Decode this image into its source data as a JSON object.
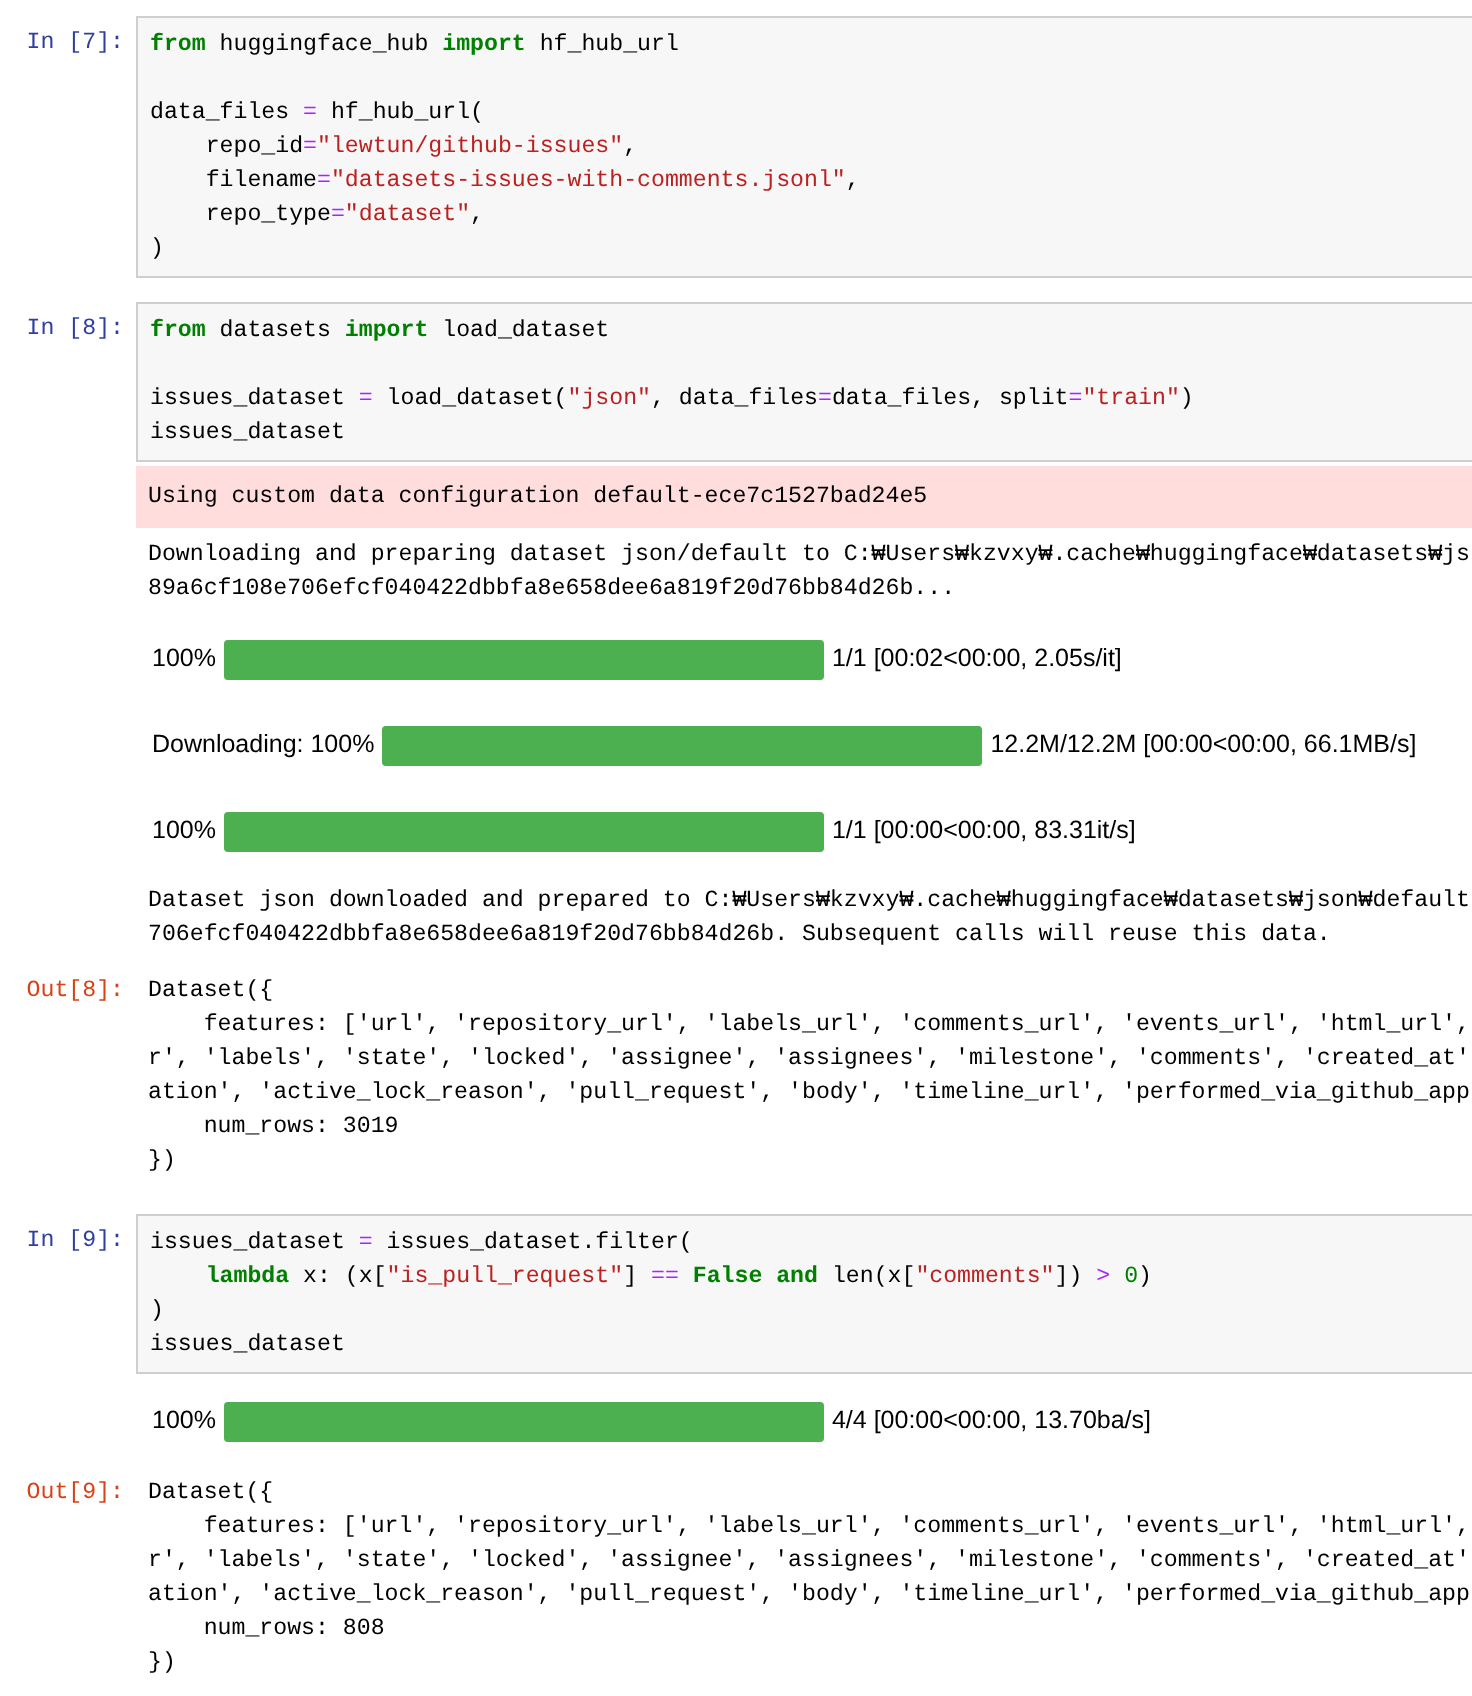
{
  "cells": [
    {
      "prompt": "In [7]:",
      "code": [
        {
          "tokens": [
            {
              "kind": "kw",
              "text": "from"
            },
            {
              "kind": "plain",
              "text": " huggingface_hub "
            },
            {
              "kind": "kw",
              "text": "import"
            },
            {
              "kind": "plain",
              "text": " hf_hub_url"
            }
          ]
        },
        {
          "kind": "blank"
        },
        {
          "tokens": [
            {
              "kind": "plain",
              "text": "data_files "
            },
            {
              "kind": "op",
              "text": "="
            },
            {
              "kind": "plain",
              "text": " hf_hub_url("
            }
          ]
        },
        {
          "tokens": [
            {
              "kind": "plain",
              "text": "    repo_id"
            },
            {
              "kind": "op",
              "text": "="
            },
            {
              "kind": "str",
              "text": "\"lewtun/github-issues\""
            },
            {
              "kind": "plain",
              "text": ","
            }
          ]
        },
        {
          "tokens": [
            {
              "kind": "plain",
              "text": "    filename"
            },
            {
              "kind": "op",
              "text": "="
            },
            {
              "kind": "str",
              "text": "\"datasets-issues-with-comments.jsonl\""
            },
            {
              "kind": "plain",
              "text": ","
            }
          ]
        },
        {
          "tokens": [
            {
              "kind": "plain",
              "text": "    repo_type"
            },
            {
              "kind": "op",
              "text": "="
            },
            {
              "kind": "str",
              "text": "\"dataset\""
            },
            {
              "kind": "plain",
              "text": ","
            }
          ]
        },
        {
          "tokens": [
            {
              "kind": "plain",
              "text": ")"
            }
          ]
        }
      ]
    },
    {
      "prompt": "In [8]:",
      "code": [
        {
          "tokens": [
            {
              "kind": "kw",
              "text": "from"
            },
            {
              "kind": "plain",
              "text": " datasets "
            },
            {
              "kind": "kw",
              "text": "import"
            },
            {
              "kind": "plain",
              "text": " load_dataset"
            }
          ]
        },
        {
          "kind": "blank"
        },
        {
          "tokens": [
            {
              "kind": "plain",
              "text": "issues_dataset "
            },
            {
              "kind": "op",
              "text": "="
            },
            {
              "kind": "plain",
              "text": " load_dataset("
            },
            {
              "kind": "str",
              "text": "\"json\""
            },
            {
              "kind": "plain",
              "text": ", data_files"
            },
            {
              "kind": "op",
              "text": "="
            },
            {
              "kind": "plain",
              "text": "data_files, split"
            },
            {
              "kind": "op",
              "text": "="
            },
            {
              "kind": "str",
              "text": "\"train\""
            },
            {
              "kind": "plain",
              "text": ")"
            }
          ]
        },
        {
          "tokens": [
            {
              "kind": "plain",
              "text": "issues_dataset"
            }
          ]
        }
      ],
      "outputs": [
        {
          "kind": "stderr",
          "lines": [
            "Using custom data configuration default-ece7c1527bad24e5"
          ]
        },
        {
          "kind": "stdout",
          "lines": [
            "Downloading and preparing dataset json/default to C:₩Users₩kzvxy₩.cache₩huggingface₩datasets₩js",
            "89a6cf108e706efcf040422dbbfa8e658dee6a819f20d76bb84d26b..."
          ]
        },
        {
          "kind": "progress",
          "label": "100%",
          "level": 1,
          "reading": "1/1 [00:02<00:00, 2.05s/it]"
        },
        {
          "kind": "progress",
          "label": "Downloading: 100%",
          "level": 1,
          "reading": "12.2M/12.2M [00:00<00:00, 66.1MB/s]"
        },
        {
          "kind": "progress",
          "label": "100%",
          "level": 1,
          "reading": "1/1 [00:00<00:00, 83.31it/s]"
        },
        {
          "kind": "stdout",
          "lines": [
            "Dataset json downloaded and prepared to C:₩Users₩kzvxy₩.cache₩huggingface₩datasets₩json₩default",
            "706efcf040422dbbfa8e658dee6a819f20d76bb84d26b. Subsequent calls will reuse this data."
          ]
        },
        {
          "kind": "result",
          "prompt": "Out[8]:",
          "lines": [
            "Dataset({",
            "    features: ['url', 'repository_url', 'labels_url', 'comments_url', 'events_url', 'html_url',",
            "r', 'labels', 'state', 'locked', 'assignee', 'assignees', 'milestone', 'comments', 'created_at'",
            "ation', 'active_lock_reason', 'pull_request', 'body', 'timeline_url', 'performed_via_github_app",
            "    num_rows: 3019",
            "})"
          ]
        }
      ]
    },
    {
      "prompt": "In [9]:",
      "code": [
        {
          "tokens": [
            {
              "kind": "plain",
              "text": "issues_dataset "
            },
            {
              "kind": "op",
              "text": "="
            },
            {
              "kind": "plain",
              "text": " issues_dataset.filter("
            }
          ]
        },
        {
          "tokens": [
            {
              "kind": "kw",
              "text": "    lambda"
            },
            {
              "kind": "plain",
              "text": " x: (x["
            },
            {
              "kind": "str",
              "text": "\"is_pull_request\""
            },
            {
              "kind": "plain",
              "text": "] "
            },
            {
              "kind": "op",
              "text": "== "
            },
            {
              "kind": "kw",
              "text": "False and"
            },
            {
              "kind": "plain",
              "text": " len(x["
            },
            {
              "kind": "str",
              "text": "\"comments\""
            },
            {
              "kind": "plain",
              "text": "]) "
            },
            {
              "kind": "op",
              "text": "> "
            },
            {
              "kind": "num",
              "text": "0"
            },
            {
              "kind": "plain",
              "text": ")"
            }
          ]
        },
        {
          "tokens": [
            {
              "kind": "plain",
              "text": ")"
            }
          ]
        },
        {
          "tokens": [
            {
              "kind": "plain",
              "text": "issues_dataset"
            }
          ]
        }
      ],
      "outputs": [
        {
          "kind": "progress",
          "label": "100%",
          "level": 1,
          "reading": "4/4 [00:00<00:00, 13.70ba/s]"
        },
        {
          "kind": "result",
          "prompt": "Out[9]:",
          "lines": [
            "Dataset({",
            "    features: ['url', 'repository_url', 'labels_url', 'comments_url', 'events_url', 'html_url',",
            "r', 'labels', 'state', 'locked', 'assignee', 'assignees', 'milestone', 'comments', 'created_at'",
            "ation', 'active_lock_reason', 'pull_request', 'body', 'timeline_url', 'performed_via_github_app",
            "    num_rows: 808",
            "})"
          ]
        }
      ]
    }
  ]
}
